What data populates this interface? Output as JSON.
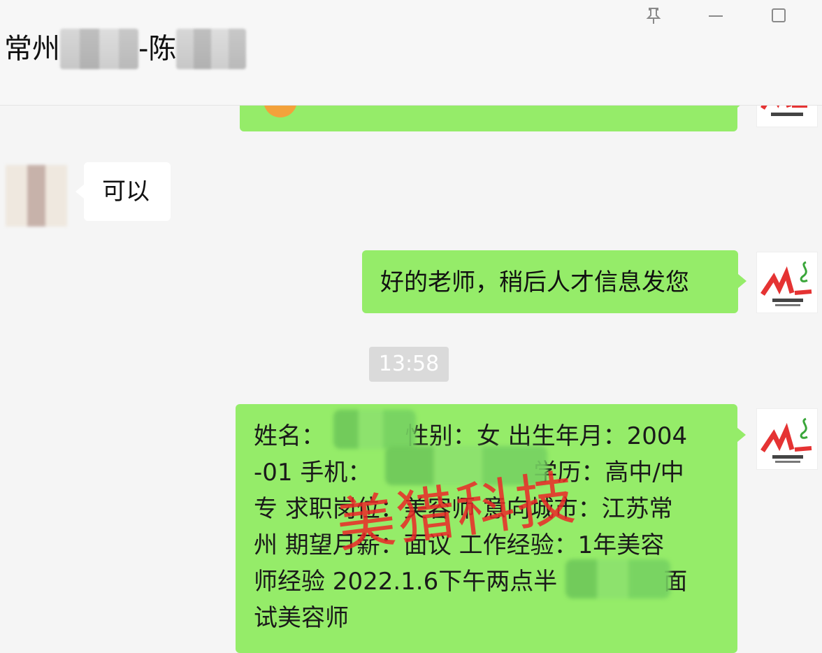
{
  "header": {
    "title_prefix": "常州",
    "title_middle": "-陈"
  },
  "chat": {
    "messages": [
      {
        "text": "可以"
      },
      {
        "text": "好的老师，稍后人才信息发您"
      },
      {
        "time": "13:58"
      }
    ],
    "resume": {
      "line1_label": "姓名：",
      "line1_rest": " 性别：女 出生年月：2004",
      "line2a": "-01 手机：",
      "line2b": "学历：高中/中",
      "line3": "专 求职岗位：美容师 意向城市：江苏常",
      "line4": "州 期望月薪：面议 工作经验：1年美容",
      "line5a": "师经验 2022.1.6下午两点半",
      "line5b": "面",
      "line6": "试美容师"
    }
  },
  "watermark": {
    "text": "美猎科技"
  },
  "icons": {
    "pin": "pin-icon",
    "minimize": "minimize-icon",
    "maximize": "maximize-icon"
  },
  "colors": {
    "bubble_green": "#95ec69",
    "watermark_red": "#eb2828"
  }
}
